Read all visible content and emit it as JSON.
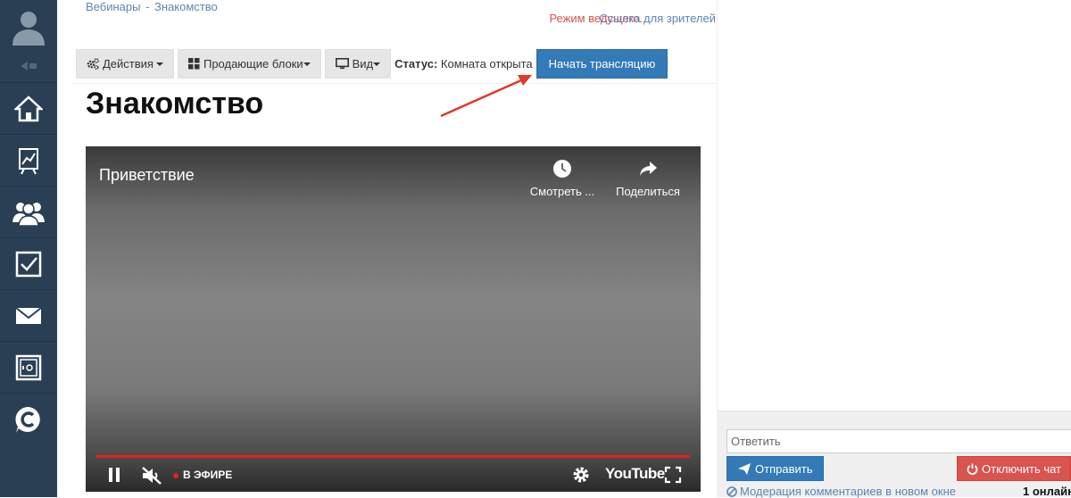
{
  "breadcrumb": {
    "root": "Вебинары",
    "current": "Знакомство"
  },
  "header": {
    "host_mode": "Режим ведущего.",
    "viewers_link": "Ссылка для зрителей"
  },
  "toolbar": {
    "actions_label": "Действия",
    "blocks_label": "Продающие блоки",
    "view_label": "Вид",
    "status_label": "Статус:",
    "status_value": "Комната открыта",
    "start_label": "Начать трансляцию"
  },
  "page": {
    "title": "Знакомство"
  },
  "video": {
    "title": "Приветствие",
    "watch_label": "Смотреть ...",
    "share_label": "Поделиться",
    "live_label": "В ЭФИРЕ",
    "brand": "YouTube"
  },
  "chat": {
    "reply_placeholder": "Ответить",
    "send_label": "Отправить",
    "disable_label": "Отключить чат",
    "moderation_link": "Модерация комментариев в новом окне",
    "online_count": "1 онлайн"
  },
  "sidebar": {
    "icons": [
      "home-icon",
      "chart-icon",
      "users-icon",
      "checkbox-icon",
      "mail-icon",
      "safe-icon",
      "coin-icon"
    ]
  },
  "colors": {
    "sidebar": "#2a3f54",
    "primary": "#337ab7",
    "danger": "#d9534f",
    "link": "#5b86b3"
  }
}
